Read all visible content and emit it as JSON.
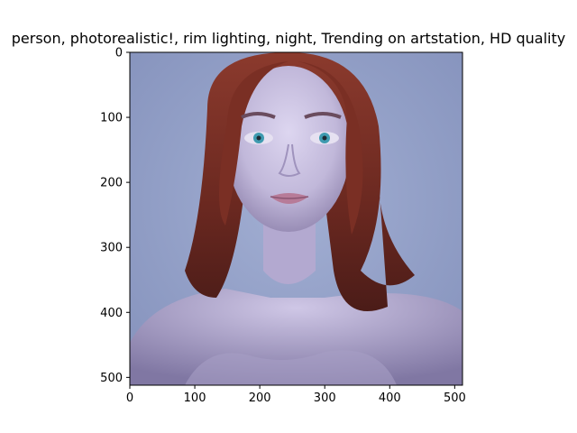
{
  "figure": {
    "title": "person,  photorealistic!, rim lighting, night, Trending on artstation, HD quality"
  },
  "image_axes": {
    "image_content": "portrait-photo",
    "x_ticks": [
      "0",
      "100",
      "200",
      "300",
      "400",
      "500"
    ],
    "y_ticks": [
      "0",
      "100",
      "200",
      "300",
      "400",
      "500"
    ],
    "x_range": [
      0,
      512
    ],
    "y_range": [
      0,
      512
    ],
    "colors": {
      "background": "#93a0c6",
      "hair": "#7a2f24",
      "skin": "#c9c2e0",
      "eyes": "#3f9bb0",
      "lips": "#b77b98"
    }
  }
}
